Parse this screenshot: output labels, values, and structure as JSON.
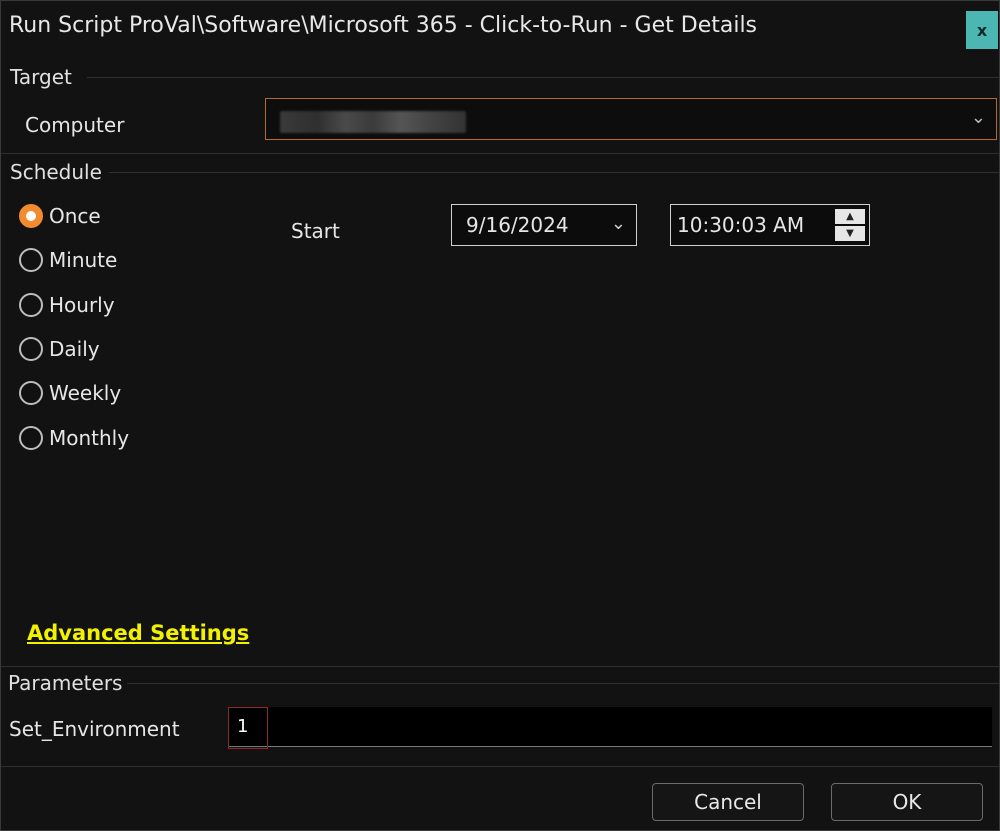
{
  "window": {
    "title": "Run Script ProVal\\Software\\Microsoft 365 - Click-to-Run - Get Details",
    "close_label": "x"
  },
  "target": {
    "group_label": "Target",
    "computer_label": "Computer",
    "computer_value": ""
  },
  "schedule": {
    "group_label": "Schedule",
    "options": [
      {
        "label": "Once",
        "checked": true
      },
      {
        "label": "Minute",
        "checked": false
      },
      {
        "label": "Hourly",
        "checked": false
      },
      {
        "label": "Daily",
        "checked": false
      },
      {
        "label": "Weekly",
        "checked": false
      },
      {
        "label": "Monthly",
        "checked": false
      }
    ],
    "start_label": "Start",
    "start_date": "9/16/2024",
    "start_time": "10:30:03 AM",
    "advanced_link": "Advanced Settings"
  },
  "parameters": {
    "group_label": "Parameters",
    "set_environment_label": "Set_Environment",
    "set_environment_value": "1"
  },
  "footer": {
    "cancel_label": "Cancel",
    "ok_label": "OK"
  },
  "colors": {
    "accent": "#f28b2e",
    "link": "#f2f200",
    "close_button": "#4cb6b3"
  }
}
